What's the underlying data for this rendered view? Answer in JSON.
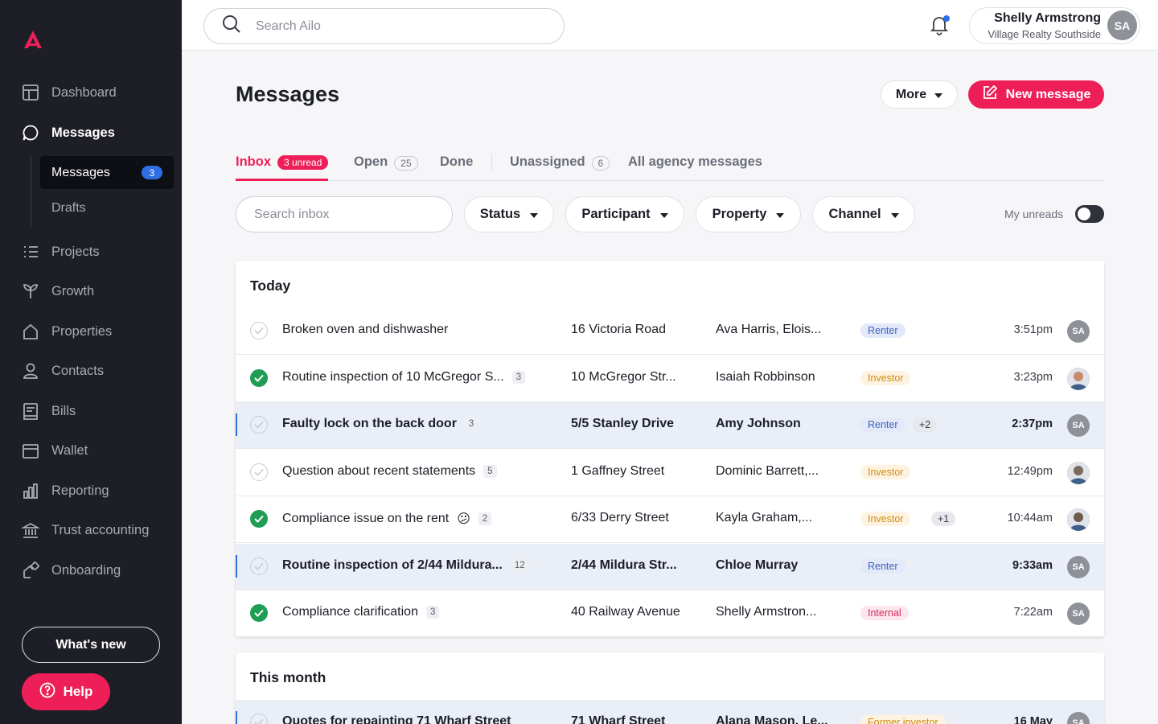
{
  "app": {
    "search_placeholder": "Search Ailo"
  },
  "user": {
    "name": "Shelly Armstrong",
    "org": "Village Realty Southside",
    "initials": "SA"
  },
  "sidebar": {
    "items": [
      {
        "label": "Dashboard",
        "icon": "dashboard-icon"
      },
      {
        "label": "Messages",
        "icon": "chat-bubble-icon"
      },
      {
        "label": "Projects",
        "icon": "list-icon"
      },
      {
        "label": "Growth",
        "icon": "sprout-icon"
      },
      {
        "label": "Properties",
        "icon": "house-icon"
      },
      {
        "label": "Contacts",
        "icon": "person-icon"
      },
      {
        "label": "Bills",
        "icon": "receipt-icon"
      },
      {
        "label": "Wallet",
        "icon": "wallet-icon"
      },
      {
        "label": "Reporting",
        "icon": "bar-chart-icon"
      },
      {
        "label": "Trust accounting",
        "icon": "bank-icon"
      },
      {
        "label": "Onboarding",
        "icon": "onboarding-icon"
      }
    ],
    "sub_items": [
      {
        "label": "Messages",
        "badge": "3"
      },
      {
        "label": "Drafts"
      }
    ],
    "whats_new": "What's new",
    "help": "Help"
  },
  "page": {
    "title": "Messages",
    "more": "More",
    "new_message": "New message"
  },
  "tabs": [
    {
      "label": "Inbox",
      "badge": "3 unread"
    },
    {
      "label": "Open",
      "count": "25"
    },
    {
      "label": "Done"
    },
    {
      "label": "Unassigned",
      "count": "6"
    },
    {
      "label": "All agency messages"
    }
  ],
  "filters": {
    "search_placeholder": "Search inbox",
    "status": "Status",
    "participant": "Participant",
    "property": "Property",
    "channel": "Channel",
    "my_unreads": "My unreads"
  },
  "groups": {
    "today": "Today",
    "this_month": "This month"
  },
  "today_rows": [
    {
      "subject": "Broken oven and dishwasher",
      "count": "",
      "property": "16 Victoria Road",
      "participants": "Ava Harris, Elois...",
      "tag": "Renter",
      "extra": "",
      "time": "3:51pm",
      "done": false,
      "unread": false
    },
    {
      "subject": "Routine inspection of 10 McGregor S...",
      "count": "3",
      "property": "10 McGregor Str...",
      "participants": "Isaiah Robbinson",
      "tag": "Investor",
      "extra": "",
      "time": "3:23pm",
      "done": true,
      "unread": false
    },
    {
      "subject": "Faulty lock on the back door",
      "count": "3",
      "property": "5/5 Stanley Drive",
      "participants": "Amy Johnson",
      "tag": "Renter",
      "extra": "+2",
      "time": "2:37pm",
      "done": false,
      "unread": true
    },
    {
      "subject": "Question about recent statements",
      "count": "5",
      "property": "1 Gaffney Street",
      "participants": "Dominic Barrett,...",
      "tag": "Investor",
      "extra": "",
      "time": "12:49pm",
      "done": false,
      "unread": false
    },
    {
      "subject": "Compliance issue on the rent",
      "emoji": "😕",
      "count": "2",
      "property": "6/33 Derry Street",
      "participants": "Kayla Graham,...",
      "tag": "Investor",
      "extra": "+1",
      "time": "10:44am",
      "done": true,
      "unread": false
    },
    {
      "subject": "Routine inspection of 2/44 Mildura...",
      "count": "12",
      "property": "2/44 Mildura Str...",
      "participants": "Chloe Murray",
      "tag": "Renter",
      "extra": "",
      "time": "9:33am",
      "done": false,
      "unread": true
    },
    {
      "subject": "Compliance clarification",
      "count": "3",
      "property": "40 Railway Avenue",
      "participants": "Shelly Armstron...",
      "tag": "Internal",
      "extra": "",
      "time": "7:22am",
      "done": true,
      "unread": false
    }
  ],
  "month_rows": [
    {
      "subject": "Quotes for repainting 71 Wharf Street",
      "property": "71 Wharf Street",
      "participants": "Alana Mason, Le...",
      "tag": "Former investor",
      "time": "16 May"
    }
  ],
  "colors": {
    "accent": "#ee1f58",
    "sidebar_bg": "#1d1e26",
    "unread_blue": "#2f6fe4",
    "done_green": "#1f9d55"
  }
}
